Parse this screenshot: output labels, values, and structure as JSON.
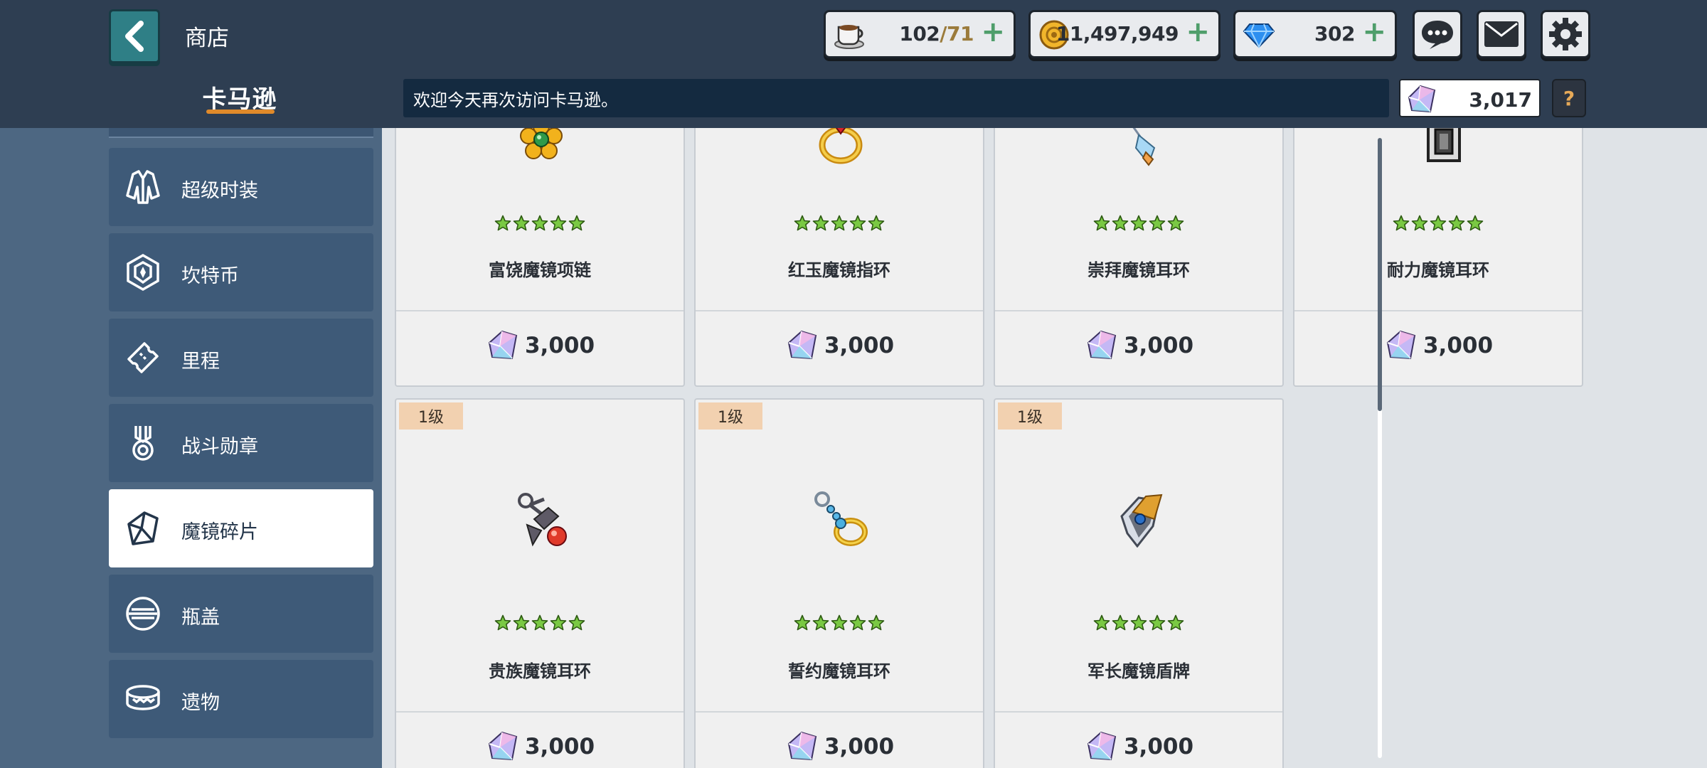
{
  "header": {
    "title": "商店",
    "shop_name": "卡马逊",
    "welcome_text": "欢迎今天再次访问卡马逊。"
  },
  "resources": {
    "stamina": {
      "current": "102",
      "max": "/71",
      "icon": "coffee-cup-icon"
    },
    "gold": {
      "value": "11,497,949",
      "icon": "gold-coin-icon"
    },
    "gems": {
      "value": "302",
      "icon": "blue-gem-icon"
    },
    "plus": "+"
  },
  "shard_balance": {
    "value": "3,017",
    "icon": "mirror-shard-icon"
  },
  "help_label": "?",
  "sidebar": {
    "items": [
      {
        "label": "超级时装",
        "icon": "costume-icon"
      },
      {
        "label": "坎特币",
        "icon": "hexagon-coin-icon"
      },
      {
        "label": "里程",
        "icon": "ticket-icon"
      },
      {
        "label": "战斗勋章",
        "icon": "medal-icon"
      },
      {
        "label": "魔镜碎片",
        "icon": "mirror-shard-icon"
      },
      {
        "label": "瓶盖",
        "icon": "bottle-cap-icon"
      },
      {
        "label": "遗物",
        "icon": "relic-icon"
      }
    ],
    "active_index": 4
  },
  "products": [
    {
      "name": "富饶魔镜项链",
      "price": "3,000",
      "stars": 5,
      "icon": "flower-necklace-icon",
      "level": ""
    },
    {
      "name": "红玉魔镜指环",
      "price": "3,000",
      "stars": 5,
      "icon": "ruby-ring-icon",
      "level": ""
    },
    {
      "name": "崇拜魔镜耳环",
      "price": "3,000",
      "stars": 5,
      "icon": "crystal-earring-icon",
      "level": ""
    },
    {
      "name": "耐力魔镜耳环",
      "price": "3,000",
      "stars": 5,
      "icon": "block-earring-icon",
      "level": ""
    },
    {
      "name": "贵族魔镜耳环",
      "price": "3,000",
      "stars": 5,
      "icon": "noble-earring-icon",
      "level": "1级"
    },
    {
      "name": "誓约魔镜耳环",
      "price": "3,000",
      "stars": 5,
      "icon": "oath-earring-icon",
      "level": "1级"
    },
    {
      "name": "军长魔镜盾牌",
      "price": "3,000",
      "stars": 5,
      "icon": "commander-shield-icon",
      "level": "1级"
    }
  ],
  "colors": {
    "accent_orange": "#e08a2a",
    "star_green": "#7ac943",
    "back_button": "#2f7f86",
    "plus_green": "#4f9e6b"
  }
}
